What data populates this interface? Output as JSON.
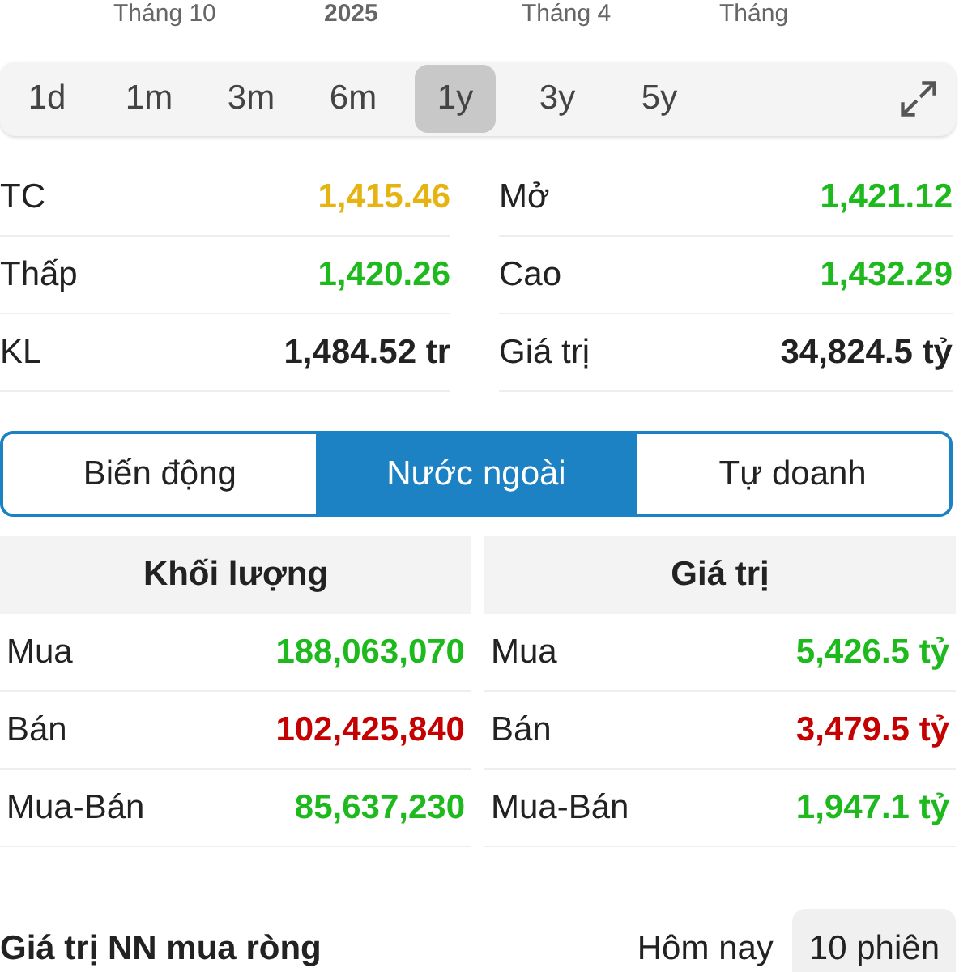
{
  "axis_labels": [
    {
      "text": "Tháng 10",
      "bold": false
    },
    {
      "text": "2025",
      "bold": true
    },
    {
      "text": "Tháng 4",
      "bold": false
    },
    {
      "text": "Tháng",
      "bold": false
    }
  ],
  "ranges": [
    {
      "label": "1d",
      "selected": false
    },
    {
      "label": "1m",
      "selected": false
    },
    {
      "label": "3m",
      "selected": false
    },
    {
      "label": "6m",
      "selected": false
    },
    {
      "label": "1y",
      "selected": true
    },
    {
      "label": "3y",
      "selected": false
    },
    {
      "label": "5y",
      "selected": false
    }
  ],
  "stats": [
    {
      "label": "TC",
      "value": "1,415.46",
      "color": "#e6b412"
    },
    {
      "label": "Mở",
      "value": "1,421.12",
      "color": "#1db91d"
    },
    {
      "label": "Thấp",
      "value": "1,420.26",
      "color": "#1db91d"
    },
    {
      "label": "Cao",
      "value": "1,432.29",
      "color": "#1db91d"
    },
    {
      "label": "KL",
      "value": "1,484.52 tr",
      "color": "#222222"
    },
    {
      "label": "Giá trị",
      "value": "34,824.5 tỷ",
      "color": "#222222"
    }
  ],
  "tabs": [
    {
      "label": "Biến động",
      "selected": false
    },
    {
      "label": "Nước ngoài",
      "selected": true
    },
    {
      "label": "Tự doanh",
      "selected": false
    }
  ],
  "tables": [
    {
      "title": "Khối lượng",
      "rows": [
        {
          "label": "Mua",
          "value": "188,063,070",
          "color": "#1db91d"
        },
        {
          "label": "Bán",
          "value": "102,425,840",
          "color": "#c40000"
        },
        {
          "label": "Mua-Bán",
          "value": "85,637,230",
          "color": "#1db91d"
        }
      ]
    },
    {
      "title": "Giá trị",
      "rows": [
        {
          "label": "Mua",
          "value": "5,426.5 tỷ",
          "color": "#1db91d"
        },
        {
          "label": "Bán",
          "value": "3,479.5 tỷ",
          "color": "#c40000"
        },
        {
          "label": "Mua-Bán",
          "value": "1,947.1 tỷ",
          "color": "#1db91d"
        }
      ]
    }
  ],
  "net_section": {
    "title": "Giá trị NN mua ròng",
    "periods": [
      {
        "label": "Hôm nay",
        "selected": false
      },
      {
        "label": "10 phiên",
        "selected": true
      }
    ]
  }
}
